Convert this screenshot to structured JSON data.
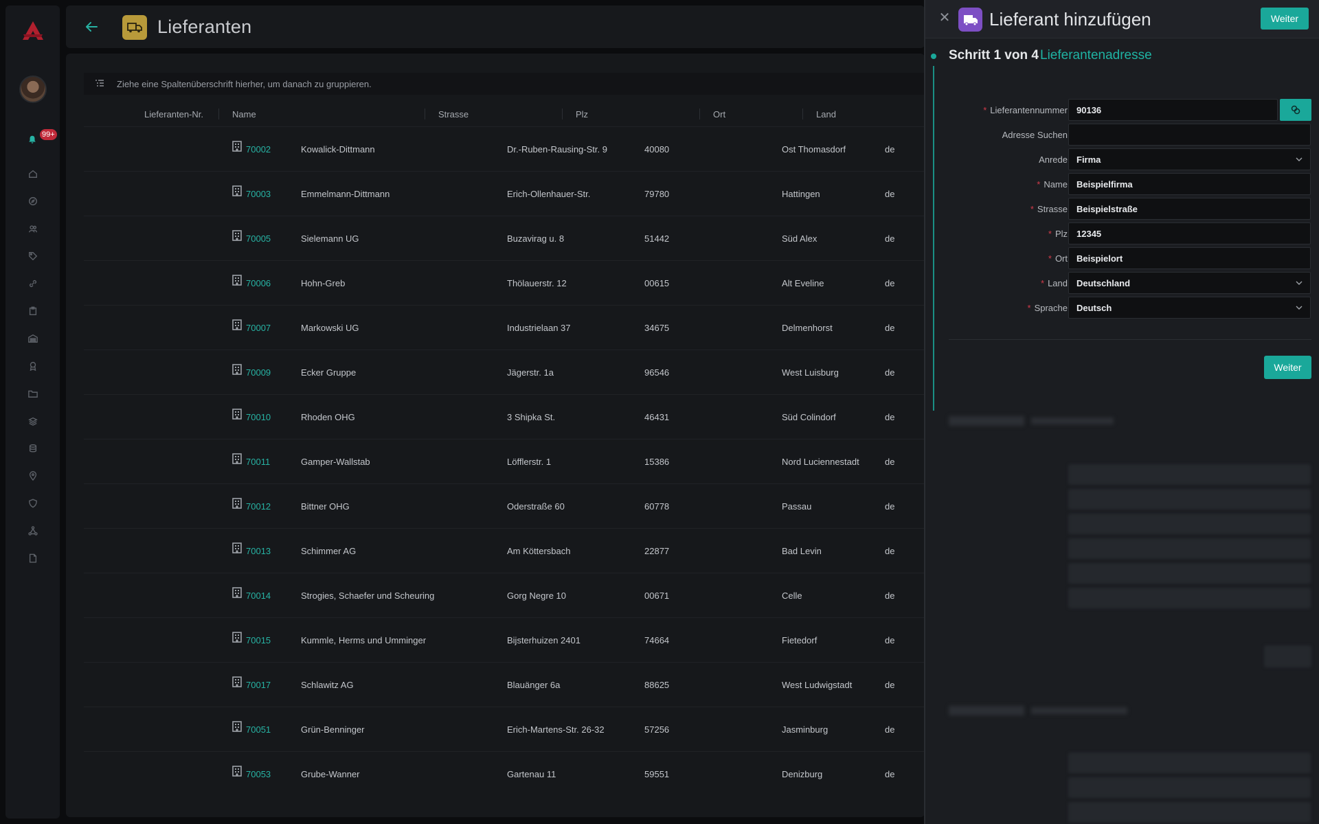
{
  "app": {
    "notification_count": "99+"
  },
  "sidebar": {
    "nav_icons": [
      "home-icon",
      "compass-icon",
      "users-icon",
      "tag-icon",
      "link-icon",
      "clipboard-icon",
      "warehouse-icon",
      "badge-icon",
      "folder-icon",
      "layers-icon",
      "database-icon",
      "location-icon",
      "shield-icon",
      "network-icon",
      "document-icon"
    ]
  },
  "header": {
    "title": "Lieferanten"
  },
  "grid": {
    "group_hint": "Ziehe eine Spaltenüberschrift hierher, um danach zu gruppieren.",
    "columns": [
      "Lieferanten-Nr.",
      "Name",
      "Strasse",
      "Plz",
      "Ort",
      "Land"
    ],
    "rows": [
      {
        "nr": "70002",
        "name": "Kowalick-Dittmann",
        "strasse": "Dr.-Ruben-Rausing-Str. 9",
        "plz": "40080",
        "ort": "Ost Thomasdorf",
        "land": "de"
      },
      {
        "nr": "70003",
        "name": "Emmelmann-Dittmann",
        "strasse": "Erich-Ollenhauer-Str.",
        "plz": "79780",
        "ort": "Hattingen",
        "land": "de"
      },
      {
        "nr": "70005",
        "name": "Sielemann UG",
        "strasse": "Buzavirag u. 8",
        "plz": "51442",
        "ort": "Süd Alex",
        "land": "de"
      },
      {
        "nr": "70006",
        "name": "Hohn-Greb",
        "strasse": "Thölauerstr. 12",
        "plz": "00615",
        "ort": "Alt Eveline",
        "land": "de"
      },
      {
        "nr": "70007",
        "name": "Markowski UG",
        "strasse": "Industrielaan 37",
        "plz": "34675",
        "ort": "Delmenhorst",
        "land": "de"
      },
      {
        "nr": "70009",
        "name": "Ecker Gruppe",
        "strasse": "Jägerstr. 1a",
        "plz": "96546",
        "ort": "West Luisburg",
        "land": "de"
      },
      {
        "nr": "70010",
        "name": "Rhoden OHG",
        "strasse": "3 Shipka St.",
        "plz": "46431",
        "ort": "Süd Colindorf",
        "land": "de"
      },
      {
        "nr": "70011",
        "name": "Gamper-Wallstab",
        "strasse": "Löfflerstr. 1",
        "plz": "15386",
        "ort": "Nord Luciennestadt",
        "land": "de"
      },
      {
        "nr": "70012",
        "name": "Bittner OHG",
        "strasse": "Oderstraße 60",
        "plz": "60778",
        "ort": "Passau",
        "land": "de"
      },
      {
        "nr": "70013",
        "name": "Schimmer AG",
        "strasse": "Am Köttersbach",
        "plz": "22877",
        "ort": "Bad Levin",
        "land": "de"
      },
      {
        "nr": "70014",
        "name": "Strogies, Schaefer und Scheuring",
        "strasse": "Gorg Negre 10",
        "plz": "00671",
        "ort": "Celle",
        "land": "de"
      },
      {
        "nr": "70015",
        "name": "Kummle, Herms und Umminger",
        "strasse": "Bijsterhuizen 2401",
        "plz": "74664",
        "ort": "Fietedorf",
        "land": "de"
      },
      {
        "nr": "70017",
        "name": "Schlawitz AG",
        "strasse": "Blauänger 6a",
        "plz": "88625",
        "ort": "West Ludwigstadt",
        "land": "de"
      },
      {
        "nr": "70051",
        "name": "Grün-Benninger",
        "strasse": "Erich-Martens-Str. 26-32",
        "plz": "57256",
        "ort": "Jasminburg",
        "land": "de"
      },
      {
        "nr": "70053",
        "name": "Grube-Wanner",
        "strasse": "Gartenau 11",
        "plz": "59551",
        "ort": "Denizburg",
        "land": "de"
      }
    ]
  },
  "drawer": {
    "title": "Lieferant hinzufügen",
    "next_label": "Weiter",
    "step_title": "Schritt 1 von 4",
    "step_name": "Lieferantenadresse",
    "fields": [
      {
        "label": "Lieferantennummer",
        "value": "90136",
        "required": true
      },
      {
        "label": "Adresse Suchen",
        "value": "",
        "required": false
      },
      {
        "label": "Anrede",
        "value": "Firma",
        "required": false
      },
      {
        "label": "Name",
        "value": "Beispielfirma",
        "required": true
      },
      {
        "label": "Strasse",
        "value": "Beispielstraße",
        "required": true
      },
      {
        "label": "Plz",
        "value": "12345",
        "required": true
      },
      {
        "label": "Ort",
        "value": "Beispielort",
        "required": true
      },
      {
        "label": "Land",
        "value": "Deutschland",
        "required": true
      },
      {
        "label": "Sprache",
        "value": "Deutsch",
        "required": true
      }
    ],
    "form_next_label": "Weiter"
  },
  "colors": {
    "accent": "#1aa89a",
    "link": "#27b3a4",
    "required": "#d23b4a",
    "drawer_icon": "#7d4fc4",
    "header_icon": "#b89a3a",
    "badge": "#c12a3a"
  }
}
